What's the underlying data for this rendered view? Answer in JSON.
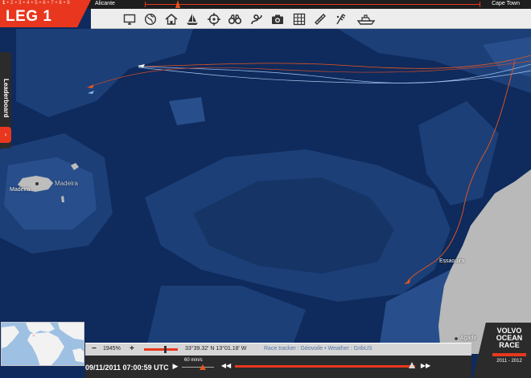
{
  "header": {
    "leg_title": "LEG 1",
    "leg_numbers": [
      "1",
      "2",
      "3",
      "4",
      "5",
      "6",
      "7",
      "8",
      "9"
    ],
    "active_leg": "1",
    "route_from": "Alicante",
    "route_to": "Cape Town"
  },
  "toolbar": {
    "tools": [
      "monitor-icon",
      "globe-icon",
      "home-icon",
      "boat-icon",
      "target-icon",
      "binoculars-icon",
      "rope-knot-icon",
      "camera-icon",
      "grid-icon",
      "ruler-icon",
      "wind-icon",
      "ship-icon"
    ]
  },
  "leaderboard": {
    "label": "Leaderboard",
    "toggle_icon": "›"
  },
  "map": {
    "places": {
      "madeira_island": "Madeira",
      "madeira_region": "Madeira",
      "essaouira": "Essaouira",
      "agadir": "Agadir"
    },
    "colors": {
      "ocean_deep": "#0f2a5c",
      "ocean_mid": "#1c3f78",
      "ocean_shallow": "#284f8c",
      "land": "#b9b9b9",
      "track_orange": "#e8571e",
      "track_blue": "#8fb8e8"
    }
  },
  "statusbar": {
    "zoom_minus": "−",
    "zoom_level": "1945%",
    "zoom_plus": "+",
    "coordinates": "33°39.32' N 13°01.18' W",
    "credits": "Race tracker : Géovoile • Weather : GribUS"
  },
  "timebar": {
    "datetime": "09/11/2011 07:00:59 UTC",
    "play_icon": "▶",
    "speed": "60 min/s",
    "prev_icon": "◀◀",
    "next_icon": "▶▶"
  },
  "logo": {
    "line1": "VOLVO",
    "line2": "OCEAN",
    "line3": "RACE",
    "years": "2011 - 2012"
  }
}
